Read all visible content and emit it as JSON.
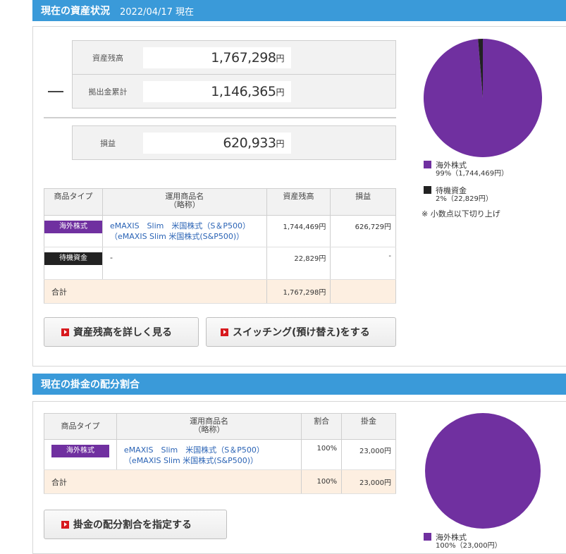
{
  "assets": {
    "title": "現在の資産状況",
    "date": "2022/04/17 現在",
    "summary": [
      {
        "label": "資産残高",
        "value": "1,767,298",
        "unit": "円"
      },
      {
        "label": "拠出金累計",
        "value": "1,146,365",
        "unit": "円"
      },
      {
        "label": "損益",
        "value": "620,933",
        "unit": "円"
      }
    ],
    "table": {
      "headers": [
        "商品タイプ",
        "運用商品名",
        "（略称）",
        "資産残高",
        "損益"
      ],
      "rows": [
        {
          "type": "海外株式",
          "name": "eMAXIS　Slim　米国株式（S＆P500）",
          "abbr": "（eMAXIS Slim 米国株式(S&P500)）",
          "balance": "1,744,469円",
          "profit": "626,729円"
        },
        {
          "type": "待機資金",
          "name": "-",
          "abbr": "",
          "balance": "22,829円",
          "profit": "-"
        }
      ],
      "total": {
        "label": "合計",
        "balance": "1,767,298円",
        "profit": ""
      }
    },
    "buttons": {
      "detail": "資産残高を詳しく見る",
      "switching": "スイッチング(預け替え)をする"
    },
    "legend": [
      {
        "label": "海外株式",
        "sub": "99%（1,744,469円）",
        "color": "#7030a0"
      },
      {
        "label": "待機資金",
        "sub": "2%（22,829円）",
        "color": "#222222"
      }
    ],
    "note": "※ 小数点以下切り上げ"
  },
  "allocation": {
    "title": "現在の掛金の配分割合",
    "table": {
      "headers": [
        "商品タイプ",
        "運用商品名",
        "（略称）",
        "割合",
        "掛金"
      ],
      "rows": [
        {
          "type": "海外株式",
          "name": "eMAXIS　Slim　米国株式（S＆P500）",
          "abbr": "（eMAXIS Slim 米国株式(S&P500)）",
          "ratio": "100%",
          "amount": "23,000円"
        }
      ],
      "total": {
        "label": "合計",
        "ratio": "100%",
        "amount": "23,000円"
      }
    },
    "buttons": {
      "set_ratio": "掛金の配分割合を指定する"
    },
    "legend": [
      {
        "label": "海外株式",
        "sub": "100%（23,000円）",
        "color": "#7030a0"
      }
    ]
  },
  "chart_data": [
    {
      "type": "pie",
      "categories": [
        "海外株式",
        "待機資金"
      ],
      "values": [
        1744469,
        22829
      ],
      "colors": [
        "#7030a0",
        "#222222"
      ]
    },
    {
      "type": "pie",
      "categories": [
        "海外株式"
      ],
      "values": [
        23000
      ],
      "colors": [
        "#7030a0"
      ]
    }
  ]
}
